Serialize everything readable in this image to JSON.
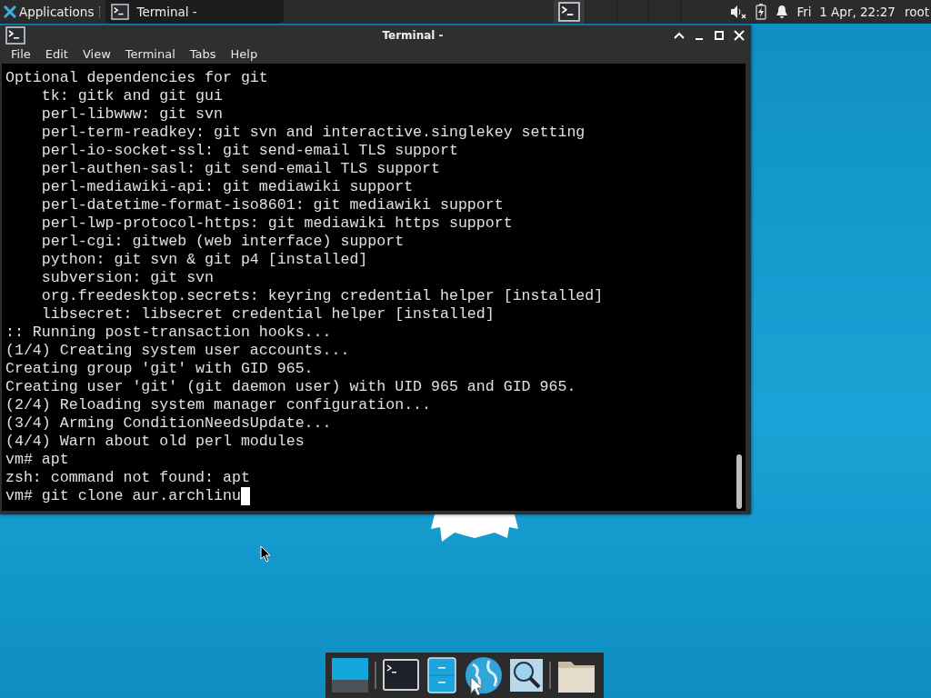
{
  "top_panel": {
    "applications_label": "Applications",
    "tasks": [
      {
        "label": "Terminal -",
        "selected": true
      }
    ],
    "clock": "Fri  1 Apr, 22:27",
    "user": "root"
  },
  "window": {
    "title": "Terminal -",
    "menu": [
      "File",
      "Edit",
      "View",
      "Terminal",
      "Tabs",
      "Help"
    ],
    "lines": [
      "Optional dependencies for git",
      "    tk: gitk and git gui",
      "    perl-libwww: git svn",
      "    perl-term-readkey: git svn and interactive.singlekey setting",
      "    perl-io-socket-ssl: git send-email TLS support",
      "    perl-authen-sasl: git send-email TLS support",
      "    perl-mediawiki-api: git mediawiki support",
      "    perl-datetime-format-iso8601: git mediawiki support",
      "    perl-lwp-protocol-https: git mediawiki https support",
      "    perl-cgi: gitweb (web interface) support",
      "    python: git svn & git p4 [installed]",
      "    subversion: git svn",
      "    org.freedesktop.secrets: keyring credential helper [installed]",
      "    libsecret: libsecret credential helper [installed]",
      ":: Running post-transaction hooks...",
      "(1/4) Creating system user accounts...",
      "Creating group 'git' with GID 965.",
      "Creating user 'git' (git daemon user) with UID 965 and GID 965.",
      "(2/4) Reloading system manager configuration...",
      "(3/4) Arming ConditionNeedsUpdate...",
      "(4/4) Warn about old perl modules",
      "vm# apt",
      "zsh: command not found: apt"
    ],
    "current_input": "vm# git clone aur.archlinu"
  }
}
